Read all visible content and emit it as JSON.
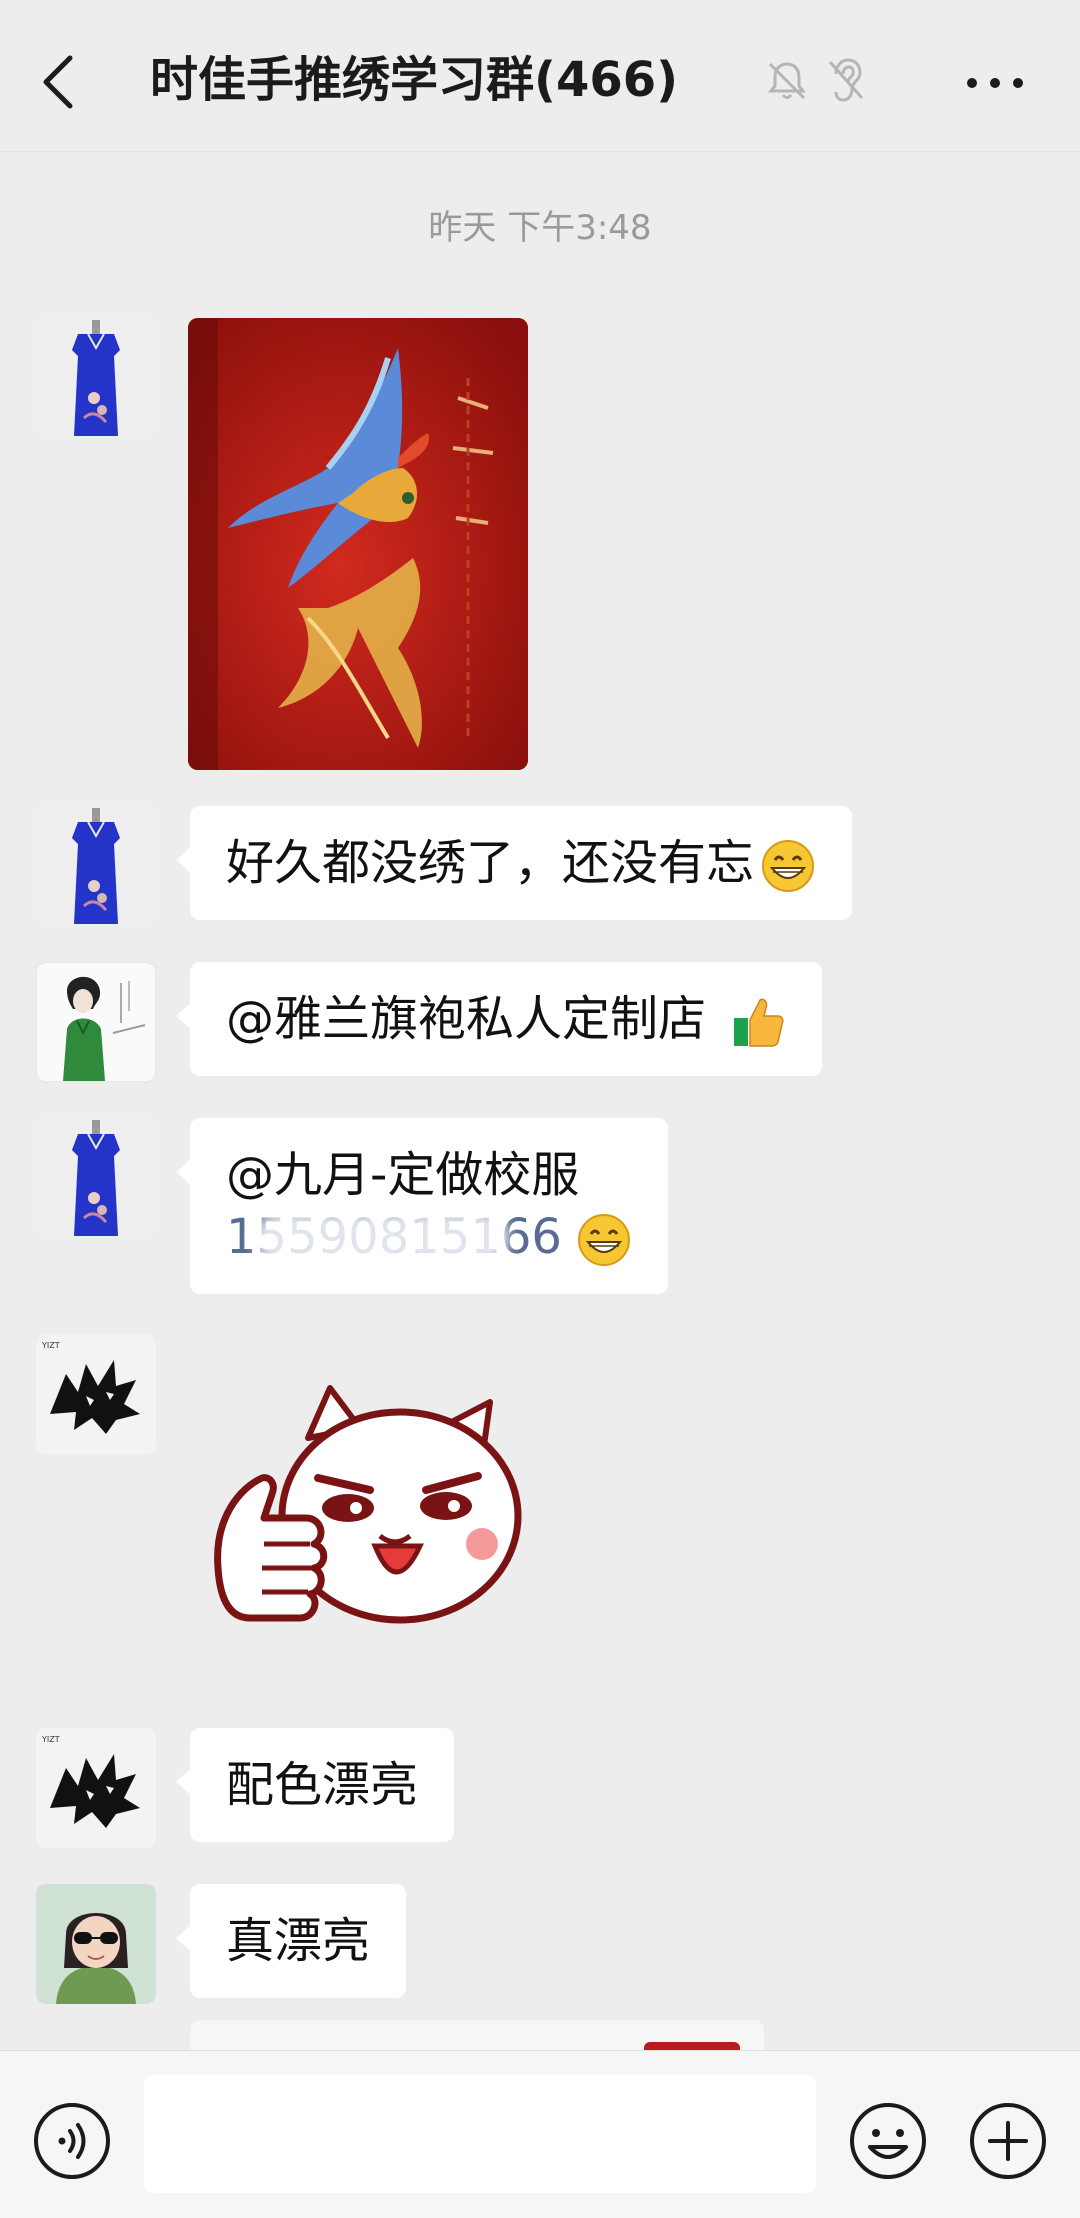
{
  "header": {
    "title": "时佳手推绣学习群(466)",
    "back_icon": "chevron-left-icon",
    "mute_icon": "bell-off-icon",
    "ear_icon": "ear-icon",
    "more_icon": "more-horizontal-icon"
  },
  "timestamp": "昨天 下午3:48",
  "messages": [
    {
      "type": "image",
      "avatar": "qipao-avatar"
    },
    {
      "type": "text",
      "avatar": "qipao-avatar",
      "text": "好久都没绣了，还没有忘",
      "emoji": "grin-emoji"
    },
    {
      "type": "text",
      "avatar": "sketch-avatar",
      "text": "@雅兰旗袍私人定制店",
      "emoji": "thumbs-up-emoji"
    },
    {
      "type": "text",
      "avatar": "qipao-avatar",
      "line1": "@九月-定做校服",
      "line2": "15590815166",
      "emoji": "grin-emoji"
    },
    {
      "type": "sticker",
      "avatar": "wolf-avatar",
      "sticker": "cat-thumbs-up-sticker"
    },
    {
      "type": "text",
      "avatar": "wolf-avatar",
      "text": "配色漂亮"
    },
    {
      "type": "text",
      "avatar": "girl-avatar",
      "text": "真漂亮"
    }
  ],
  "input": {
    "placeholder": "",
    "voice_icon": "voice-icon",
    "emoji_icon": "smiley-icon",
    "plus_icon": "plus-circle-icon"
  },
  "colors": {
    "background": "#ededed",
    "bubble": "#ffffff",
    "link": "#576b95",
    "timestamp": "#9a9a9a"
  }
}
